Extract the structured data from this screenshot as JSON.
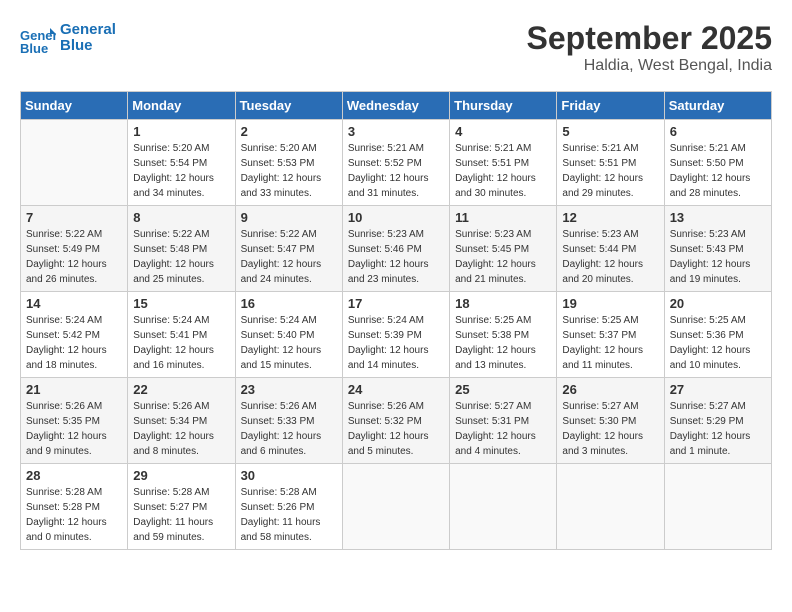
{
  "header": {
    "logo_line1": "General",
    "logo_line2": "Blue",
    "month": "September 2025",
    "location": "Haldia, West Bengal, India"
  },
  "weekdays": [
    "Sunday",
    "Monday",
    "Tuesday",
    "Wednesday",
    "Thursday",
    "Friday",
    "Saturday"
  ],
  "weeks": [
    [
      {
        "day": "",
        "info": ""
      },
      {
        "day": "1",
        "info": "Sunrise: 5:20 AM\nSunset: 5:54 PM\nDaylight: 12 hours\nand 34 minutes."
      },
      {
        "day": "2",
        "info": "Sunrise: 5:20 AM\nSunset: 5:53 PM\nDaylight: 12 hours\nand 33 minutes."
      },
      {
        "day": "3",
        "info": "Sunrise: 5:21 AM\nSunset: 5:52 PM\nDaylight: 12 hours\nand 31 minutes."
      },
      {
        "day": "4",
        "info": "Sunrise: 5:21 AM\nSunset: 5:51 PM\nDaylight: 12 hours\nand 30 minutes."
      },
      {
        "day": "5",
        "info": "Sunrise: 5:21 AM\nSunset: 5:51 PM\nDaylight: 12 hours\nand 29 minutes."
      },
      {
        "day": "6",
        "info": "Sunrise: 5:21 AM\nSunset: 5:50 PM\nDaylight: 12 hours\nand 28 minutes."
      }
    ],
    [
      {
        "day": "7",
        "info": "Sunrise: 5:22 AM\nSunset: 5:49 PM\nDaylight: 12 hours\nand 26 minutes."
      },
      {
        "day": "8",
        "info": "Sunrise: 5:22 AM\nSunset: 5:48 PM\nDaylight: 12 hours\nand 25 minutes."
      },
      {
        "day": "9",
        "info": "Sunrise: 5:22 AM\nSunset: 5:47 PM\nDaylight: 12 hours\nand 24 minutes."
      },
      {
        "day": "10",
        "info": "Sunrise: 5:23 AM\nSunset: 5:46 PM\nDaylight: 12 hours\nand 23 minutes."
      },
      {
        "day": "11",
        "info": "Sunrise: 5:23 AM\nSunset: 5:45 PM\nDaylight: 12 hours\nand 21 minutes."
      },
      {
        "day": "12",
        "info": "Sunrise: 5:23 AM\nSunset: 5:44 PM\nDaylight: 12 hours\nand 20 minutes."
      },
      {
        "day": "13",
        "info": "Sunrise: 5:23 AM\nSunset: 5:43 PM\nDaylight: 12 hours\nand 19 minutes."
      }
    ],
    [
      {
        "day": "14",
        "info": "Sunrise: 5:24 AM\nSunset: 5:42 PM\nDaylight: 12 hours\nand 18 minutes."
      },
      {
        "day": "15",
        "info": "Sunrise: 5:24 AM\nSunset: 5:41 PM\nDaylight: 12 hours\nand 16 minutes."
      },
      {
        "day": "16",
        "info": "Sunrise: 5:24 AM\nSunset: 5:40 PM\nDaylight: 12 hours\nand 15 minutes."
      },
      {
        "day": "17",
        "info": "Sunrise: 5:24 AM\nSunset: 5:39 PM\nDaylight: 12 hours\nand 14 minutes."
      },
      {
        "day": "18",
        "info": "Sunrise: 5:25 AM\nSunset: 5:38 PM\nDaylight: 12 hours\nand 13 minutes."
      },
      {
        "day": "19",
        "info": "Sunrise: 5:25 AM\nSunset: 5:37 PM\nDaylight: 12 hours\nand 11 minutes."
      },
      {
        "day": "20",
        "info": "Sunrise: 5:25 AM\nSunset: 5:36 PM\nDaylight: 12 hours\nand 10 minutes."
      }
    ],
    [
      {
        "day": "21",
        "info": "Sunrise: 5:26 AM\nSunset: 5:35 PM\nDaylight: 12 hours\nand 9 minutes."
      },
      {
        "day": "22",
        "info": "Sunrise: 5:26 AM\nSunset: 5:34 PM\nDaylight: 12 hours\nand 8 minutes."
      },
      {
        "day": "23",
        "info": "Sunrise: 5:26 AM\nSunset: 5:33 PM\nDaylight: 12 hours\nand 6 minutes."
      },
      {
        "day": "24",
        "info": "Sunrise: 5:26 AM\nSunset: 5:32 PM\nDaylight: 12 hours\nand 5 minutes."
      },
      {
        "day": "25",
        "info": "Sunrise: 5:27 AM\nSunset: 5:31 PM\nDaylight: 12 hours\nand 4 minutes."
      },
      {
        "day": "26",
        "info": "Sunrise: 5:27 AM\nSunset: 5:30 PM\nDaylight: 12 hours\nand 3 minutes."
      },
      {
        "day": "27",
        "info": "Sunrise: 5:27 AM\nSunset: 5:29 PM\nDaylight: 12 hours\nand 1 minute."
      }
    ],
    [
      {
        "day": "28",
        "info": "Sunrise: 5:28 AM\nSunset: 5:28 PM\nDaylight: 12 hours\nand 0 minutes."
      },
      {
        "day": "29",
        "info": "Sunrise: 5:28 AM\nSunset: 5:27 PM\nDaylight: 11 hours\nand 59 minutes."
      },
      {
        "day": "30",
        "info": "Sunrise: 5:28 AM\nSunset: 5:26 PM\nDaylight: 11 hours\nand 58 minutes."
      },
      {
        "day": "",
        "info": ""
      },
      {
        "day": "",
        "info": ""
      },
      {
        "day": "",
        "info": ""
      },
      {
        "day": "",
        "info": ""
      }
    ]
  ]
}
